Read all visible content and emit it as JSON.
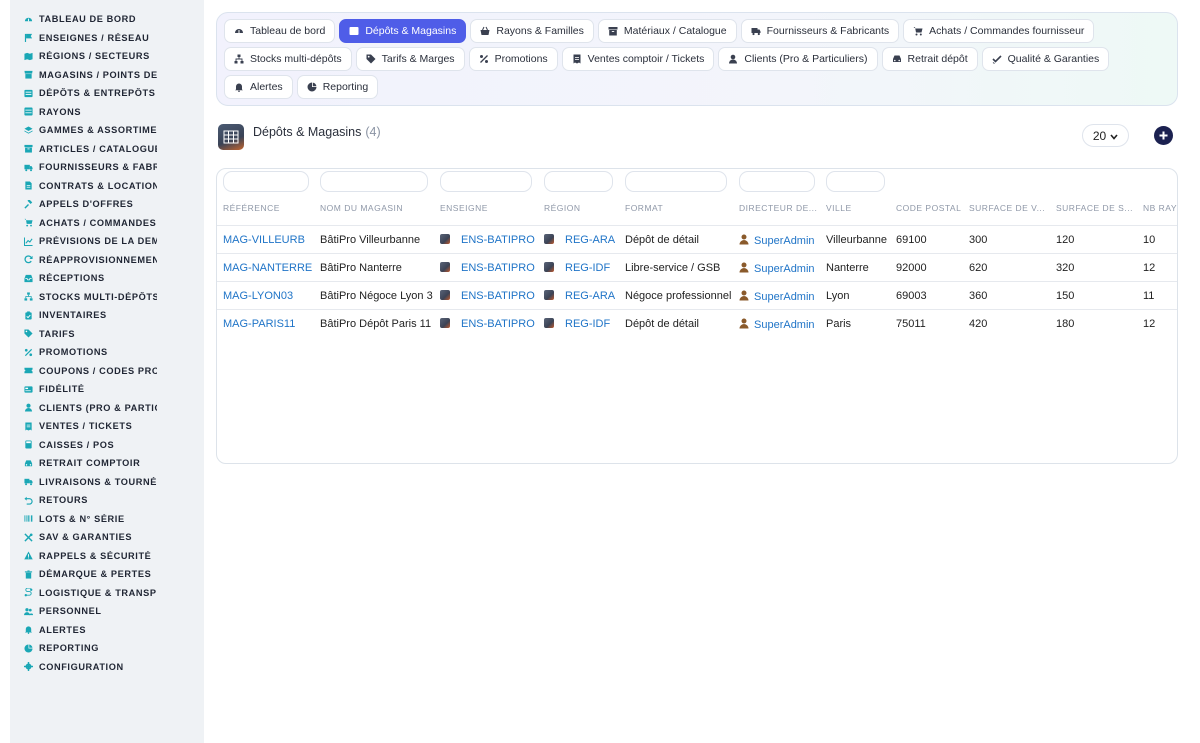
{
  "sidebar": {
    "items": [
      {
        "label": "TABLEAU DE BORD",
        "icon": "dashboard-icon"
      },
      {
        "label": "ENSEIGNES / RÉSEAU",
        "icon": "flag-icon"
      },
      {
        "label": "RÉGIONS / SECTEURS",
        "icon": "map-icon"
      },
      {
        "label": "MAGASINS / POINTS DE V",
        "icon": "store-icon"
      },
      {
        "label": "DÉPÔTS & ENTREPÔTS",
        "icon": "warehouse-icon"
      },
      {
        "label": "RAYONS",
        "icon": "shelf-icon"
      },
      {
        "label": "GAMMES & ASSORTIMENT",
        "icon": "layers-icon"
      },
      {
        "label": "ARTICLES / CATALOGUE",
        "icon": "box-icon"
      },
      {
        "label": "FOURNISSEURS & FABRI(",
        "icon": "truck-icon"
      },
      {
        "label": "CONTRATS & LOCATION",
        "icon": "document-icon"
      },
      {
        "label": "APPELS D'OFFRES",
        "icon": "gavel-icon"
      },
      {
        "label": "ACHATS / COMMANDES F",
        "icon": "cart-icon"
      },
      {
        "label": "PRÉVISIONS DE LA DEMA",
        "icon": "chart-icon"
      },
      {
        "label": "RÉAPPROVISIONNEMENT",
        "icon": "refresh-icon"
      },
      {
        "label": "RÉCEPTIONS",
        "icon": "inbox-icon"
      },
      {
        "label": "STOCKS MULTI-DÉPÔTS",
        "icon": "sitemap-icon"
      },
      {
        "label": "INVENTAIRES",
        "icon": "clipboard-icon"
      },
      {
        "label": "TARIFS",
        "icon": "tag-icon"
      },
      {
        "label": "PROMOTIONS",
        "icon": "percent-icon"
      },
      {
        "label": "COUPONS / CODES PROM",
        "icon": "ticket-icon"
      },
      {
        "label": "FIDÉLITÉ",
        "icon": "card-icon"
      },
      {
        "label": "CLIENTS (PRO & PARTICU",
        "icon": "user-icon"
      },
      {
        "label": "VENTES / TICKETS",
        "icon": "receipt-icon"
      },
      {
        "label": "CAISSES / POS",
        "icon": "register-icon"
      },
      {
        "label": "RETRAIT COMPTOIR",
        "icon": "car-icon"
      },
      {
        "label": "LIVRAISONS & TOURNÉES",
        "icon": "delivery-icon"
      },
      {
        "label": "RETOURS",
        "icon": "undo-icon"
      },
      {
        "label": "LOTS & N° SÉRIE",
        "icon": "barcode-icon"
      },
      {
        "label": "SAV & GARANTIES",
        "icon": "tools-icon"
      },
      {
        "label": "RAPPELS & SÉCURITÉ",
        "icon": "warning-icon"
      },
      {
        "label": "DÉMARQUE & PERTES",
        "icon": "trash-icon"
      },
      {
        "label": "LOGISTIQUE & TRANSPO",
        "icon": "route-icon"
      },
      {
        "label": "PERSONNEL",
        "icon": "users-icon"
      },
      {
        "label": "ALERTES",
        "icon": "bell-icon"
      },
      {
        "label": "REPORTING",
        "icon": "pie-icon"
      },
      {
        "label": "CONFIGURATION",
        "icon": "gear-icon"
      }
    ]
  },
  "tabs": [
    {
      "label": "Tableau de bord",
      "icon": "dashboard-icon",
      "active": false
    },
    {
      "label": "Dépôts & Magasins",
      "icon": "warehouse-icon",
      "active": true
    },
    {
      "label": "Rayons & Familles",
      "icon": "basket-icon",
      "active": false
    },
    {
      "label": "Matériaux / Catalogue",
      "icon": "box-icon",
      "active": false
    },
    {
      "label": "Fournisseurs & Fabricants",
      "icon": "truck-icon",
      "active": false
    },
    {
      "label": "Achats / Commandes fournisseur",
      "icon": "cart-icon",
      "active": false
    },
    {
      "label": "Stocks multi-dépôts",
      "icon": "sitemap-icon",
      "active": false
    },
    {
      "label": "Tarifs & Marges",
      "icon": "tag-icon",
      "active": false
    },
    {
      "label": "Promotions",
      "icon": "percent-icon",
      "active": false
    },
    {
      "label": "Ventes comptoir / Tickets",
      "icon": "receipt-icon",
      "active": false
    },
    {
      "label": "Clients (Pro & Particuliers)",
      "icon": "user-icon",
      "active": false
    },
    {
      "label": "Retrait dépôt",
      "icon": "car-icon",
      "active": false
    },
    {
      "label": "Qualité & Garanties",
      "icon": "check-icon",
      "active": false
    },
    {
      "label": "Alertes",
      "icon": "bell-icon",
      "active": false
    },
    {
      "label": "Reporting",
      "icon": "pie-icon",
      "active": false
    }
  ],
  "header": {
    "title": "Dépôts & Magasins",
    "count": "(4)",
    "per_page": "20"
  },
  "table": {
    "columns": [
      "RÉFÉRENCE",
      "NOM DU MAGASIN",
      "ENSEIGNE",
      "RÉGION",
      "FORMAT",
      "DIRECTEUR DE...",
      "VILLE",
      "CODE POSTAL",
      "SURFACE DE V...",
      "SURFACE DE S...",
      "NB RAYO"
    ],
    "rows": [
      [
        "MAG-VILLEURB",
        "BâtiPro Villeurbanne",
        "ENS-BATIPRO",
        "REG-ARA",
        "Dépôt de détail",
        "SuperAdmin",
        "Villeurbanne",
        "69100",
        "300",
        "120",
        "10"
      ],
      [
        "MAG-NANTERRE",
        "BâtiPro Nanterre",
        "ENS-BATIPRO",
        "REG-IDF",
        "Libre-service / GSB",
        "SuperAdmin",
        "Nanterre",
        "92000",
        "620",
        "320",
        "12"
      ],
      [
        "MAG-LYON03",
        "BâtiPro Négoce Lyon 3",
        "ENS-BATIPRO",
        "REG-ARA",
        "Négoce professionnel",
        "SuperAdmin",
        "Lyon",
        "69003",
        "360",
        "150",
        "11"
      ],
      [
        "MAG-PARIS11",
        "BâtiPro Dépôt Paris 11",
        "ENS-BATIPRO",
        "REG-IDF",
        "Dépôt de détail",
        "SuperAdmin",
        "Paris",
        "75011",
        "420",
        "180",
        "12"
      ]
    ]
  },
  "colors": {
    "accent": "#4f5de8",
    "icon_teal": "#1aa7b5",
    "link": "#1f74c7",
    "add_button": "#1b2150"
  }
}
